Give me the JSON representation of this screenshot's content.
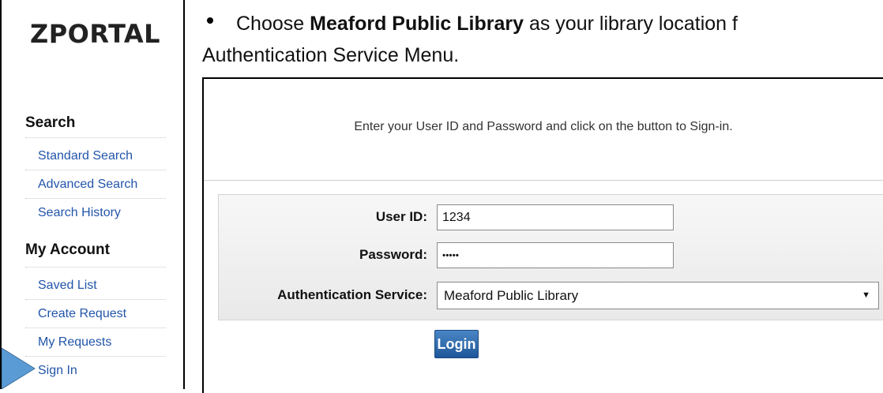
{
  "logo": "ZPORTAL",
  "sidebar": {
    "search_heading": "Search",
    "search_links": [
      "Standard Search",
      "Advanced Search",
      "Search History"
    ],
    "account_heading": "My Account",
    "account_links": [
      "Saved List",
      "Create Request",
      "My Requests",
      "Sign In"
    ]
  },
  "instruction": {
    "choose": "Choose ",
    "library": "Meaford Public Library",
    "rest": " as your library location f",
    "line2": "Authentication Service Menu."
  },
  "login": {
    "message": "Enter your User ID and Password and click on the button to Sign-in.",
    "user_id_label": "User ID:",
    "user_id_value": "1234",
    "password_label": "Password:",
    "password_value": "•••••",
    "auth_label": "Authentication Service:",
    "auth_value": "Meaford Public Library",
    "login_button": "Login"
  },
  "colors": {
    "link": "#2255aa",
    "pointer_arrow": "#5b9bd5",
    "login_button": "#1e5799"
  }
}
